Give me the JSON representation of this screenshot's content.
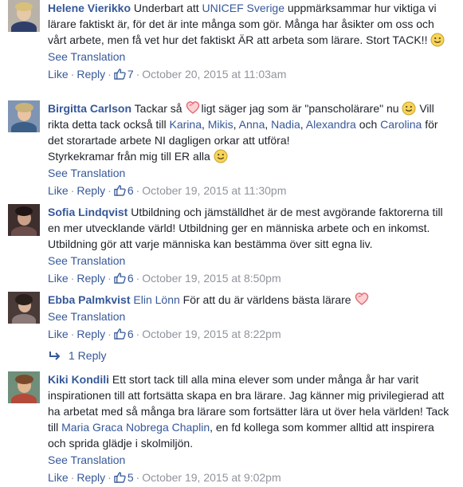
{
  "comments": [
    {
      "author": "Helene Vierikko",
      "segments": [
        {
          "t": "text",
          "v": "Underbart att "
        },
        {
          "t": "link",
          "v": "UNICEF Sverige"
        },
        {
          "t": "text",
          "v": " uppmärksammar hur viktiga vi lärare faktiskt är, för det är inte många som gör. Många har åsikter om oss och vårt arbete, men få vet hur det faktiskt ÄR att arbeta som lärare. Stort TACK!! "
        },
        {
          "t": "emoji",
          "v": "smiley"
        }
      ],
      "see_translation": "See Translation",
      "like": "Like",
      "reply": "Reply",
      "likes": "7",
      "time": "October 20, 2015 at 11:03am"
    },
    {
      "author": "Birgitta Carlson",
      "segments": [
        {
          "t": "text",
          "v": "Tackar så "
        },
        {
          "t": "emoji",
          "v": "heart"
        },
        {
          "t": "text",
          "v": "ligt säger jag som är \"panscholärare\" nu "
        },
        {
          "t": "emoji",
          "v": "smiley"
        },
        {
          "t": "text",
          "v": " Vill rikta detta tack också till "
        },
        {
          "t": "link",
          "v": "Karina"
        },
        {
          "t": "text",
          "v": ", "
        },
        {
          "t": "link",
          "v": "Mikis"
        },
        {
          "t": "text",
          "v": ", "
        },
        {
          "t": "link",
          "v": "Anna"
        },
        {
          "t": "text",
          "v": ", "
        },
        {
          "t": "link",
          "v": "Nadia"
        },
        {
          "t": "text",
          "v": ", "
        },
        {
          "t": "link",
          "v": "Alexandra"
        },
        {
          "t": "text",
          "v": " och "
        },
        {
          "t": "link",
          "v": "Carolina"
        },
        {
          "t": "text",
          "v": " för det storartade arbete NI dagligen orkar att utföra!"
        },
        {
          "t": "br"
        },
        {
          "t": "text",
          "v": "Styrkekramar från mig till ER alla "
        },
        {
          "t": "emoji",
          "v": "smiley"
        }
      ],
      "see_translation": "See Translation",
      "like": "Like",
      "reply": "Reply",
      "likes": "6",
      "time": "October 19, 2015 at 11:30pm"
    },
    {
      "author": "Sofia Lindqvist",
      "segments": [
        {
          "t": "text",
          "v": "Utbildning och jämställdhet är de mest avgörande faktorerna till en mer utvecklande värld! Utbildning ger en människa arbete och en inkomst. Utbildning gör att varje människa kan bestämma över sitt egna liv."
        }
      ],
      "see_translation": "See Translation",
      "like": "Like",
      "reply": "Reply",
      "likes": "6",
      "time": "October 19, 2015 at 8:50pm"
    },
    {
      "author": "Ebba Palmkvist",
      "segments": [
        {
          "t": "link",
          "v": "Elin Lönn"
        },
        {
          "t": "text",
          "v": " För att du är världens bästa lärare "
        },
        {
          "t": "emoji",
          "v": "heart"
        }
      ],
      "see_translation": "See Translation",
      "like": "Like",
      "reply": "Reply",
      "likes": "6",
      "time": "October 19, 2015 at 8:22pm"
    },
    {
      "author": "Kiki Kondili",
      "segments": [
        {
          "t": "text",
          "v": "Ett stort tack till alla mina elever som under många år har varit inspirationen till att fortsätta skapa en bra lärare. Jag känner mig privilegierad att ha arbetat med så många bra lärare som fortsätter lära ut över hela världen! Tack till "
        },
        {
          "t": "link",
          "v": "Maria Graca Nobrega Chaplin"
        },
        {
          "t": "text",
          "v": ", en fd kollega som kommer alltid att inspirera och sprida glädje i skolmiljön."
        }
      ],
      "see_translation": "See Translation",
      "like": "Like",
      "reply": "Reply",
      "likes": "5",
      "time": "October 19, 2015 at 9:02pm"
    }
  ],
  "replies_link": "1 Reply",
  "colors": {
    "link": "#365899",
    "meta": "#90949c",
    "text": "#1d2129"
  }
}
